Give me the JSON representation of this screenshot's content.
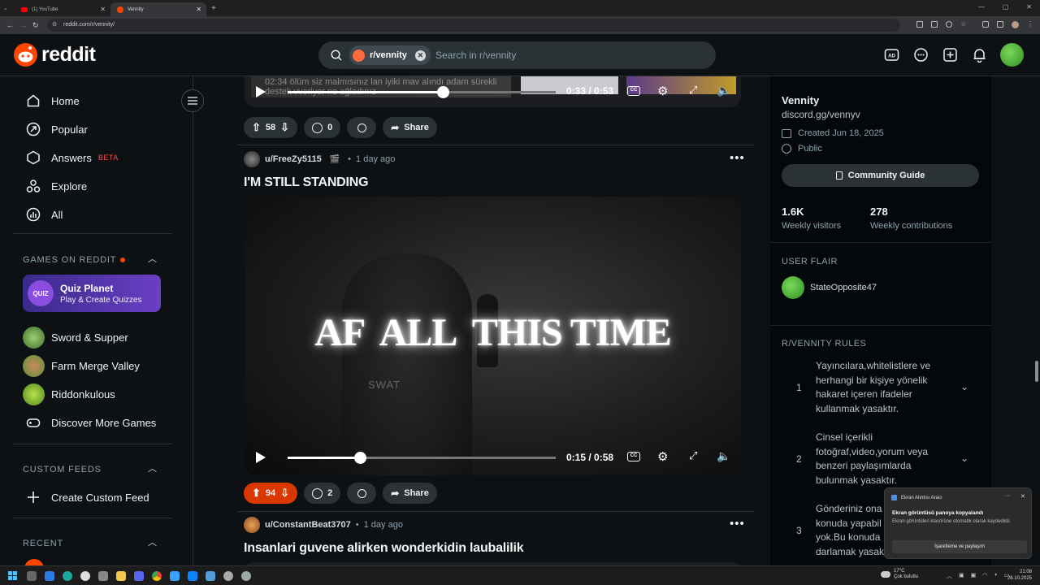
{
  "browser": {
    "tabs": [
      {
        "title": "(1) YouTube",
        "active": false
      },
      {
        "title": "Vennity",
        "active": true
      }
    ],
    "url": "reddit.com/r/vennity/"
  },
  "header": {
    "logo_text": "reddit",
    "subreddit_chip": "r/vennity",
    "search_placeholder": "Search in r/vennity"
  },
  "sidebar": {
    "nav": [
      {
        "label": "Home",
        "icon": "home-icon"
      },
      {
        "label": "Popular",
        "icon": "popular-icon"
      },
      {
        "label": "Answers",
        "badge": "BETA",
        "icon": "answers-icon"
      },
      {
        "label": "Explore",
        "icon": "explore-icon"
      },
      {
        "label": "All",
        "icon": "all-icon"
      }
    ],
    "games_heading": "GAMES ON REDDIT",
    "featured_game": {
      "icon_text": "QUIZ",
      "title": "Quiz Planet",
      "subtitle": "Play & Create Quizzes"
    },
    "games": [
      "Sword & Supper",
      "Farm Merge Valley",
      "Riddonkulous"
    ],
    "discover_label": "Discover More Games",
    "custom_feeds_heading": "CUSTOM FEEDS",
    "create_feed_label": "Create Custom Feed",
    "recent_heading": "RECENT"
  },
  "feed": {
    "top_post": {
      "video_time_current": "0:33",
      "video_time_total": "0:53",
      "video_progress": 0.58,
      "video_overlay_text": "02:34 ölüm siz malmısınız lan iyiki mav alındı adam sürekli destek vveriyor ne ağladınız",
      "upvotes": "58",
      "comments": "0",
      "share_label": "Share"
    },
    "post": {
      "author": "u/FreeZy5115",
      "time": "1 day ago",
      "title": "I'M STILL STANDING",
      "video_text": "AF  ALL  THIS TIME",
      "video_badge": "SWAT",
      "video_time_current": "0:15",
      "video_time_total": "0:58",
      "video_progress": 0.27,
      "upvotes": "94",
      "comments": "2",
      "share_label": "Share"
    },
    "next_post": {
      "author": "u/ConstantBeat3707",
      "time": "1 day ago",
      "title": "Insanlari guvene alirken wonderkidin laubalilik"
    }
  },
  "right_sidebar": {
    "name": "Vennity",
    "link": "discord.gg/vennyv",
    "created": "Created Jun 18, 2025",
    "visibility": "Public",
    "guide_button": "Community Guide",
    "stats": [
      {
        "value": "1.6K",
        "label": "Weekly visitors"
      },
      {
        "value": "278",
        "label": "Weekly contributions"
      }
    ],
    "flair_heading": "USER FLAIR",
    "flair_user": "StateOpposite47",
    "rules_heading": "R/VENNITY RULES",
    "rules": [
      {
        "num": "1",
        "text": "Yayıncılara,whitelistlere ve herhangi bir kişiye yönelik hakaret içeren ifadeler kullanmak yasaktır."
      },
      {
        "num": "2",
        "text": "Cinsel içerikli fotoğraf,video,yorum veya benzeri paylaşımlarda bulunmak yasaktır."
      },
      {
        "num": "3",
        "text": "Gönderiniz ona konuda yapabil yok.Bu konuda darlamak yasak"
      }
    ]
  },
  "toast": {
    "app": "Ekran Alıntısı Aracı",
    "title": "Ekran görüntüsü panoya kopyalandı",
    "body": "Ekran görüntüleri klasörüne otomatik olarak kaydedildi.",
    "button": "İşaretleme ve paylaşım"
  },
  "taskbar": {
    "weather_temp": "17°C",
    "weather_desc": "Çok bulutlu",
    "time": "21:08",
    "date": "26.10.2025"
  },
  "colors": {
    "accent": "#d93900",
    "bg": "#0e1113",
    "surface": "#2a3236",
    "brand": "#ff4500"
  }
}
